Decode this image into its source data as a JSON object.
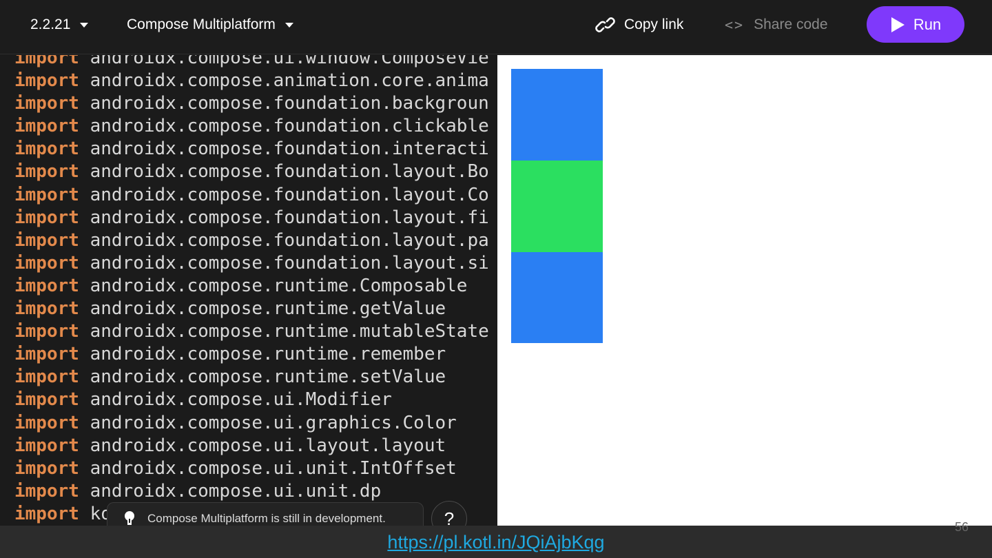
{
  "toolbar": {
    "version": "2.2.21",
    "platform": "Compose Multiplatform",
    "copy_link": "Copy link",
    "share_code": "Share code",
    "share_glyph": "<>",
    "run": "Run",
    "run_color": "#7f39fb"
  },
  "editor": {
    "keyword": "import",
    "lines": [
      "androidx.compose.ui.window.ComposeVie",
      "androidx.compose.animation.core.anima",
      "androidx.compose.foundation.backgroun",
      "androidx.compose.foundation.clickable",
      "androidx.compose.foundation.interacti",
      "androidx.compose.foundation.layout.Bo",
      "androidx.compose.foundation.layout.Co",
      "androidx.compose.foundation.layout.fi",
      "androidx.compose.foundation.layout.pa",
      "androidx.compose.foundation.layout.si",
      "androidx.compose.runtime.Composable",
      "androidx.compose.runtime.getValue",
      "androidx.compose.runtime.mutableState",
      "androidx.compose.runtime.remember",
      "androidx.compose.runtime.setValue",
      "androidx.compose.ui.Modifier",
      "androidx.compose.ui.graphics.Color",
      "androidx.compose.ui.layout.layout",
      "androidx.compose.ui.unit.IntOffset",
      "androidx.compose.ui.unit.dp",
      "ko"
    ],
    "keyword_color": "#e2894b"
  },
  "notice": {
    "text": "Compose Multiplatform is still in development.",
    "icon": "lightbulb-icon"
  },
  "help": {
    "label": "?"
  },
  "preview": {
    "boxes": [
      {
        "color": "#2a7ff3"
      },
      {
        "color": "#2bdf60"
      },
      {
        "color": "#2a7ff3"
      }
    ]
  },
  "footer": {
    "url": "https://pl.kotl.in/JQiAjbKqg",
    "slide_number": "56"
  }
}
